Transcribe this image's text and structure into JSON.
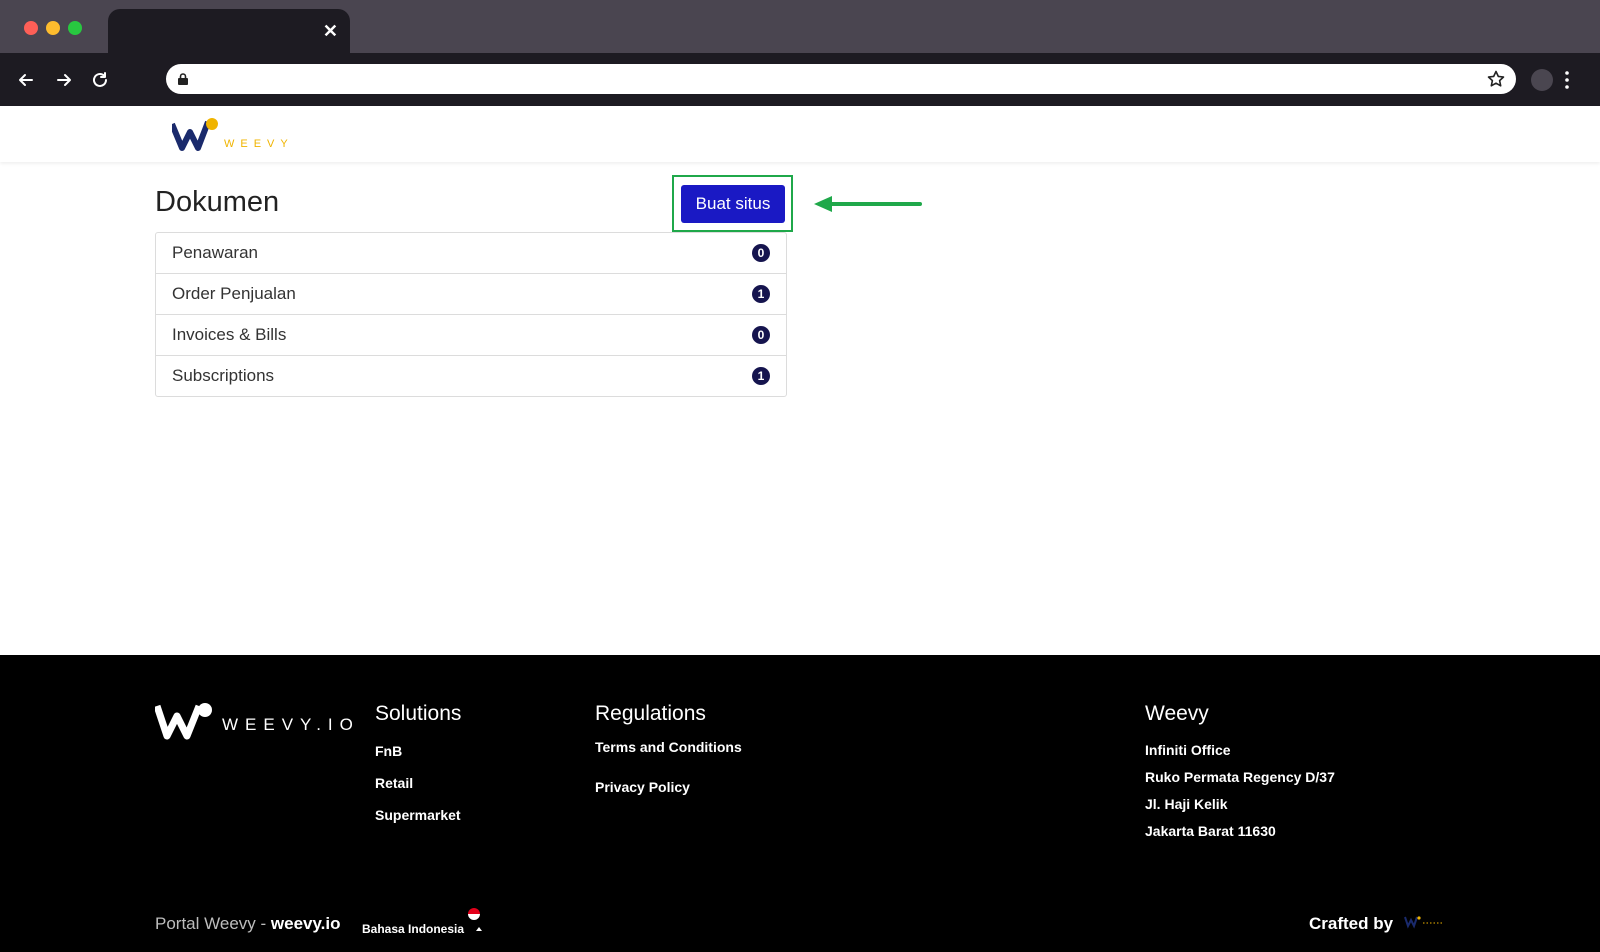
{
  "browser": {
    "tab_close": "✕"
  },
  "header": {
    "logo_text": "WEEVY",
    "brand_colors": {
      "navy": "#1a2a6c",
      "gold": "#f0b400"
    }
  },
  "main": {
    "title": "Dokumen",
    "create_button": "Buat situs",
    "button_color": "#1a19c4",
    "highlight_color": "#1fa84a",
    "documents": [
      {
        "label": "Penawaran",
        "count": "0"
      },
      {
        "label": "Order Penjualan",
        "count": "1"
      },
      {
        "label": "Invoices & Bills",
        "count": "0"
      },
      {
        "label": "Subscriptions",
        "count": "1"
      }
    ]
  },
  "footer": {
    "logo_text": "WEEVY.IO",
    "solutions": {
      "title": "Solutions",
      "links": [
        "FnB",
        "Retail",
        "Supermarket"
      ]
    },
    "regulations": {
      "title": "Regulations",
      "links": [
        "Terms and Conditions",
        "Privacy Policy"
      ]
    },
    "company": {
      "title": "Weevy",
      "address": [
        "Infiniti Office",
        "Ruko Permata Regency D/37",
        "Jl. Haji Kelik",
        "Jakarta Barat 11630"
      ]
    },
    "portal_prefix": "Portal Weevy - ",
    "portal_domain": "weevy.io",
    "language": "Bahasa Indonesia",
    "crafted_by": "Crafted by"
  }
}
